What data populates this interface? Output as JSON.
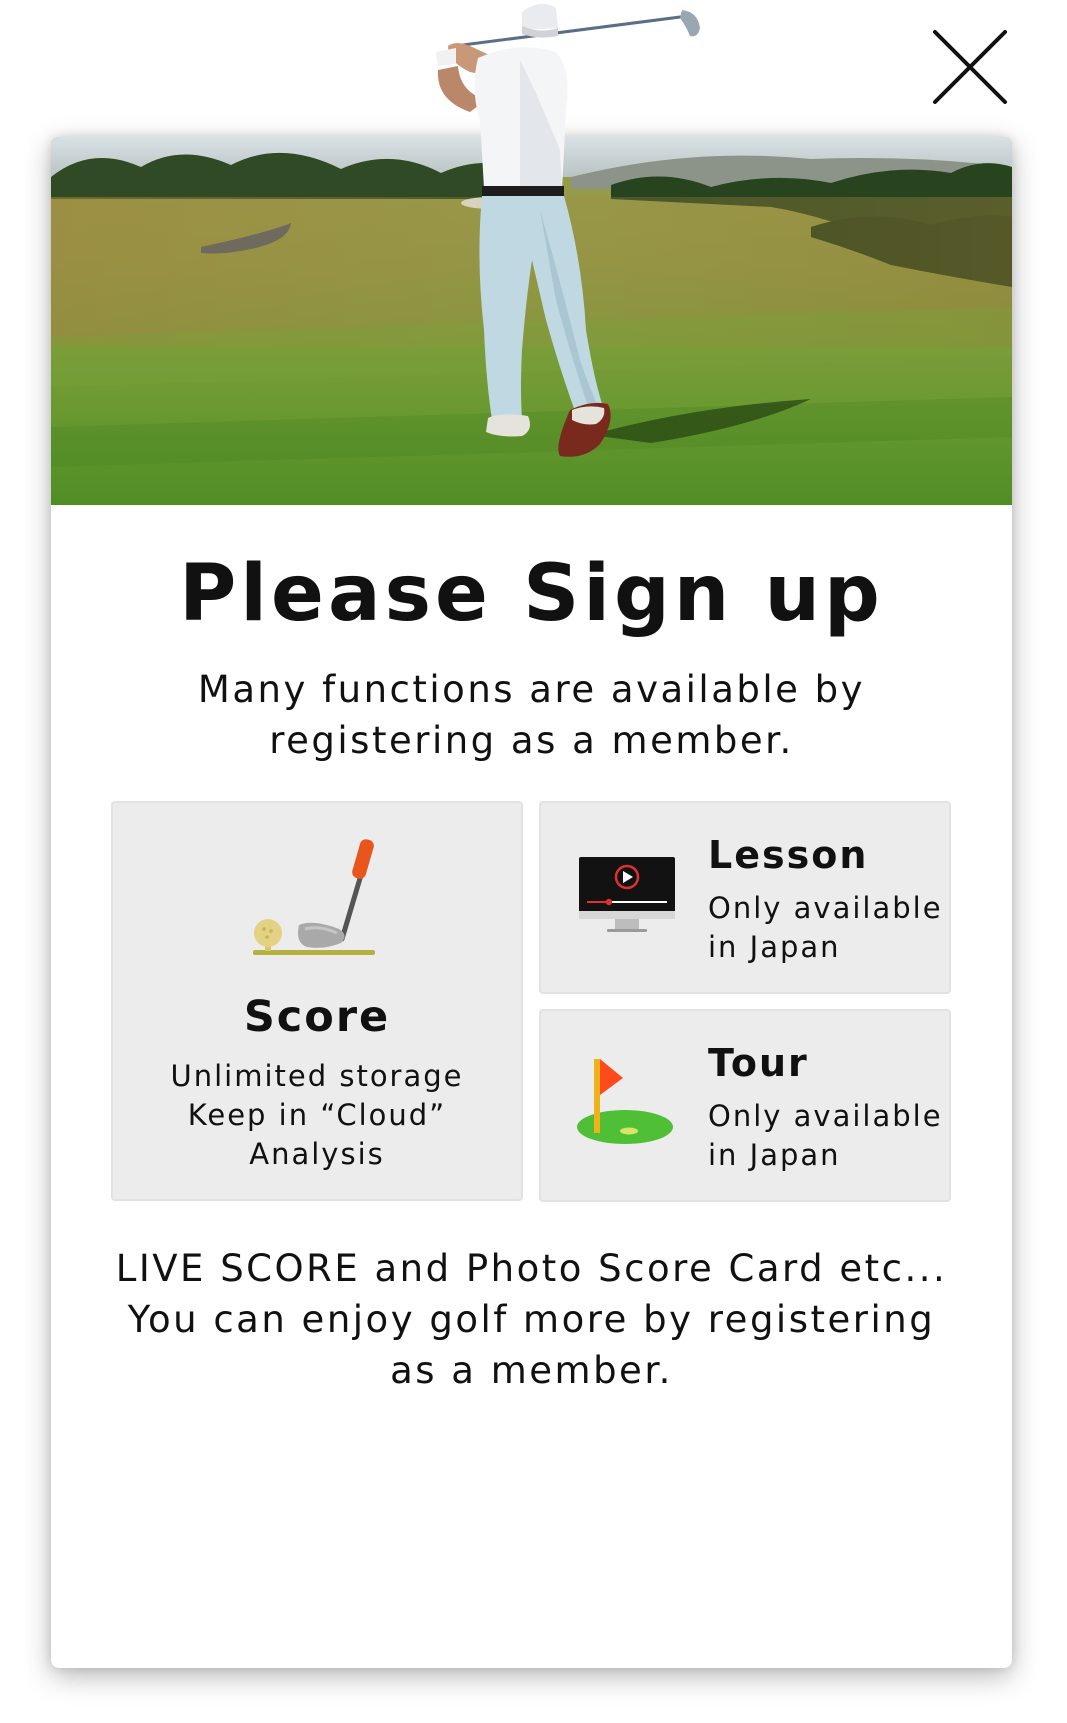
{
  "dialog": {
    "close_icon": "close-icon",
    "hero_image": "golfer-photo"
  },
  "header": {
    "title": "Please Sign up",
    "subtitle_line1": "Many functions are available by",
    "subtitle_line2": "registering as a member."
  },
  "features": {
    "score": {
      "icon": "golf-club-icon",
      "title": "Score",
      "lines": [
        "Unlimited storage",
        "Keep in “Cloud”",
        "Analysis"
      ]
    },
    "lesson": {
      "icon": "video-monitor-icon",
      "title": "Lesson",
      "lines": [
        "Only available",
        "in Japan"
      ]
    },
    "tour": {
      "icon": "golf-flag-icon",
      "title": "Tour",
      "lines": [
        "Only available",
        "in Japan"
      ]
    }
  },
  "footer": {
    "line1": "LIVE SCORE and Photo Score Card etc...",
    "line2": "You can enjoy golf more by registering",
    "line3": "as a member."
  },
  "colors": {
    "tile_background": "#ececec",
    "club_grip": "#e8561b",
    "flag": "#ff4a1c",
    "green": "#4fbf36"
  }
}
